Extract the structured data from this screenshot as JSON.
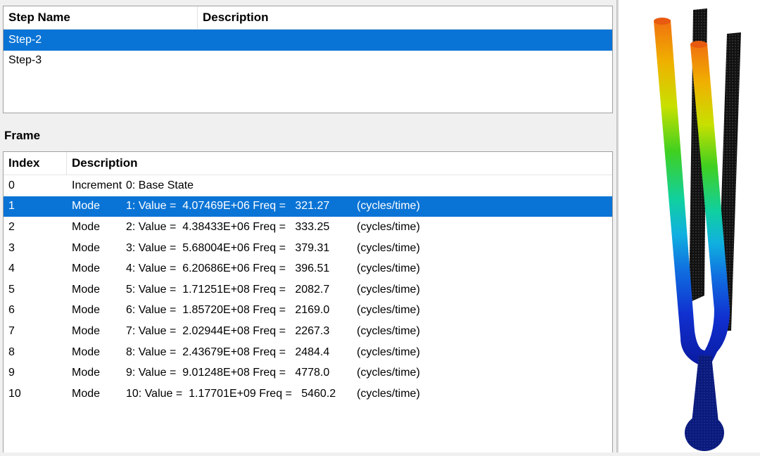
{
  "steps": {
    "headers": [
      "Step Name",
      "Description"
    ],
    "rows": [
      {
        "name": "Step-2",
        "selected": true
      },
      {
        "name": "Step-3",
        "selected": false
      }
    ]
  },
  "frame": {
    "label": "Frame",
    "headers": [
      "Index",
      "Description"
    ],
    "rows": [
      {
        "index": "0",
        "kind": "Increment",
        "desc": "0: Base State",
        "units": "",
        "selected": false
      },
      {
        "index": "1",
        "kind": "Mode",
        "desc": "1: Value =  4.07469E+06 Freq =   321.27",
        "units": "(cycles/time)",
        "selected": true
      },
      {
        "index": "2",
        "kind": "Mode",
        "desc": "2: Value =  4.38433E+06 Freq =   333.25",
        "units": "(cycles/time)",
        "selected": false
      },
      {
        "index": "3",
        "kind": "Mode",
        "desc": "3: Value =  5.68004E+06 Freq =   379.31",
        "units": "(cycles/time)",
        "selected": false
      },
      {
        "index": "4",
        "kind": "Mode",
        "desc": "4: Value =  6.20686E+06 Freq =   396.51",
        "units": "(cycles/time)",
        "selected": false
      },
      {
        "index": "5",
        "kind": "Mode",
        "desc": "5: Value =  1.71251E+08 Freq =   2082.7",
        "units": "(cycles/time)",
        "selected": false
      },
      {
        "index": "6",
        "kind": "Mode",
        "desc": "6: Value =  1.85720E+08 Freq =   2169.0",
        "units": "(cycles/time)",
        "selected": false
      },
      {
        "index": "7",
        "kind": "Mode",
        "desc": "7: Value =  2.02944E+08 Freq =   2267.3",
        "units": "(cycles/time)",
        "selected": false
      },
      {
        "index": "8",
        "kind": "Mode",
        "desc": "8: Value =  2.43679E+08 Freq =   2484.4",
        "units": "(cycles/time)",
        "selected": false
      },
      {
        "index": "9",
        "kind": "Mode",
        "desc": "9: Value =  9.01248E+08 Freq =   4778.0",
        "units": "(cycles/time)",
        "selected": false
      },
      {
        "index": "10",
        "kind": "Mode",
        "desc": "10: Value =  1.17701E+09 Freq =   5460.2",
        "units": "(cycles/time)",
        "selected": false
      }
    ]
  },
  "viewport": {
    "model": "tuning-fork-mode-shape"
  },
  "colors": {
    "selection": "#0a74d6"
  }
}
